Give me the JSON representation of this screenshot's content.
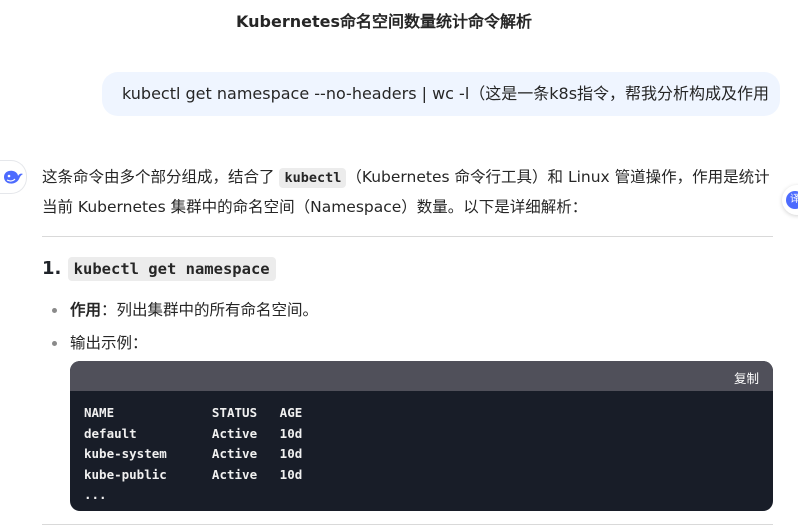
{
  "header": {
    "title": "Kubernetes命名空间数量统计命令解析"
  },
  "user_message": {
    "text": "kubectl get namespace --no-headers | wc -l（这是一条k8s指令，帮我分析构成及作用"
  },
  "sidebar": {
    "translate_label": "译"
  },
  "answer": {
    "intro_before": "这条命令由多个部分组成，结合了 ",
    "intro_code": "kubectl",
    "intro_after": "（Kubernetes 命令行工具）和 Linux 管道操作，作用是统计当前 Kubernetes 集群中的命名空间（Namespace）数量。以下是详细解析：",
    "section1": {
      "number": "1.",
      "code": "kubectl get namespace",
      "bullets": [
        {
          "label": "作用",
          "text": "：列出集群中的所有命名空间。"
        },
        {
          "label": "",
          "text": "输出示例："
        }
      ]
    },
    "code_block": {
      "copy_label": "复制",
      "lines": [
        "NAME             STATUS   AGE",
        "default          Active   10d",
        "kube-system      Active   10d",
        "kube-public      Active   10d",
        "..."
      ]
    }
  },
  "colors": {
    "user_bubble": "#eff5ff",
    "accent": "#4d6bfe",
    "code_bg": "#181d28",
    "code_header": "#50505a"
  }
}
